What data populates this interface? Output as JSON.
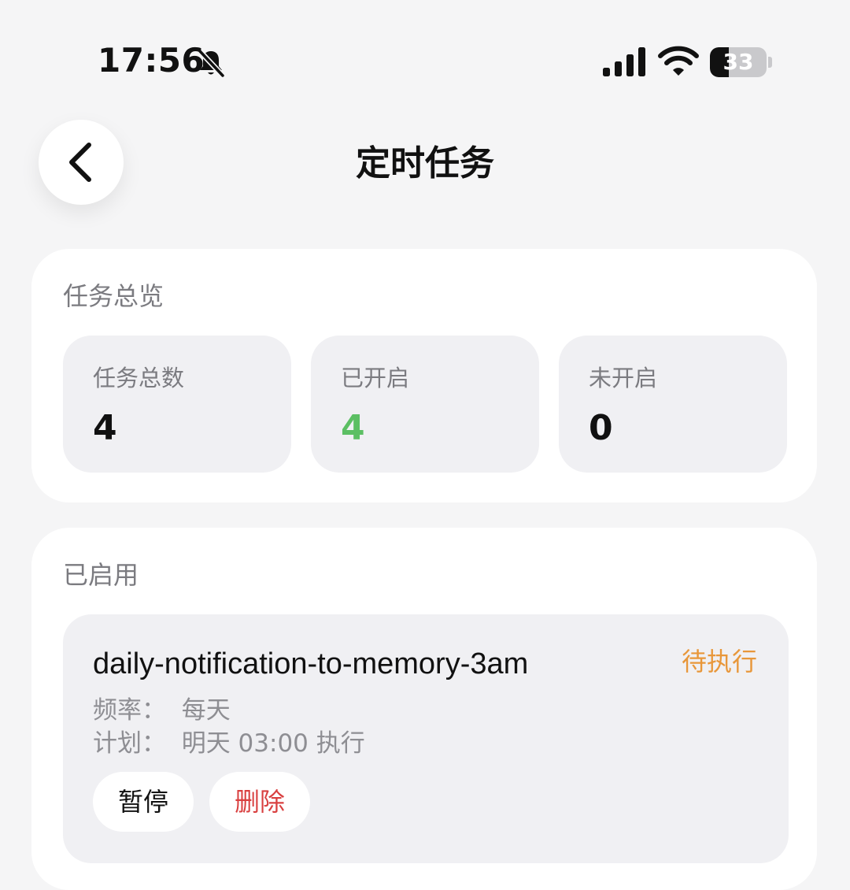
{
  "status_bar": {
    "time": "17:56",
    "battery_level": "33",
    "battery_fraction": 0.33,
    "icons": [
      "bell-slash-icon",
      "signal-icon",
      "wifi-icon",
      "battery-icon"
    ]
  },
  "header": {
    "title": "定时任务",
    "back_icon": "chevron-left-icon"
  },
  "overview": {
    "section_title": "任务总览",
    "stats": [
      {
        "label": "任务总数",
        "value": "4"
      },
      {
        "label": "已开启",
        "value": "4",
        "color": "#5cbf63"
      },
      {
        "label": "未开启",
        "value": "0"
      }
    ]
  },
  "enabled": {
    "section_title": "已启用",
    "tasks": [
      {
        "name": "daily-notification-to-memory-3am",
        "status": "待执行",
        "status_color": "#e8973a",
        "frequency": "频率：  每天",
        "schedule": "计划：  明天 03:00 执行",
        "pause_label": "暂停",
        "delete_label": "删除",
        "delete_color": "#d94040"
      }
    ]
  }
}
